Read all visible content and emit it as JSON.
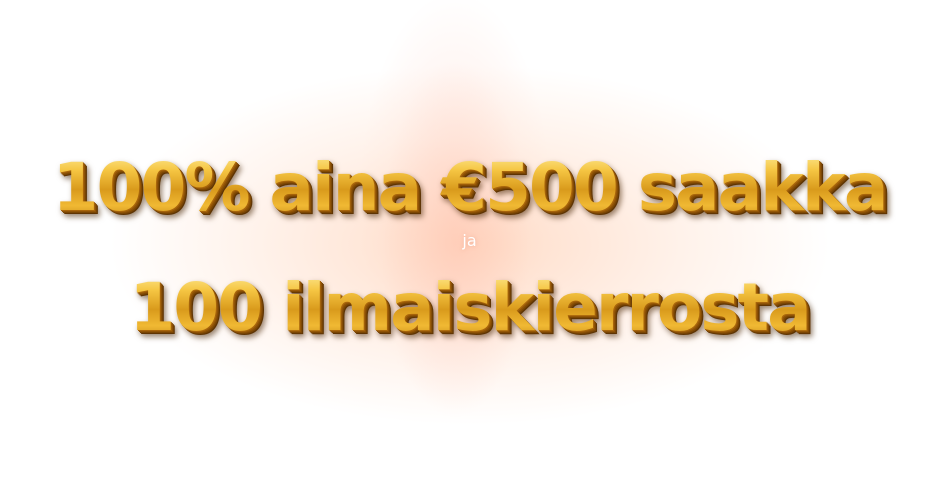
{
  "banner": {
    "line_1": "100% aina €500 saakka",
    "connector": "ja",
    "line_2": "100 ilmaiskierrosta"
  },
  "colors": {
    "gold_light": "#fff3a8",
    "gold_mid": "#f5c542",
    "gold_dark": "#b3720e",
    "glow": "#ffd6be"
  }
}
